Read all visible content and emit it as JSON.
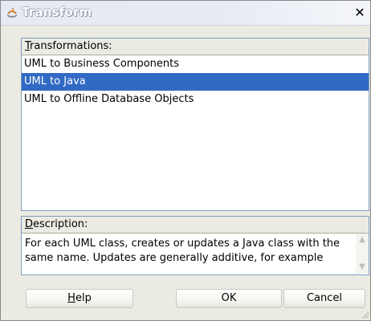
{
  "window": {
    "title": "Transform",
    "close_glyph": "✕",
    "icon": "transform-icon"
  },
  "transformations": {
    "header_accesskey": "T",
    "header_rest": "ransformations:",
    "items": [
      {
        "label": "UML to Business Components",
        "selected": false
      },
      {
        "label": "UML to Java",
        "selected": true
      },
      {
        "label": "UML to Offline Database Objects",
        "selected": false
      }
    ]
  },
  "description": {
    "header_accesskey": "D",
    "header_rest": "escription:",
    "text": "For each UML class, creates or updates a Java class with the same name. Updates are generally additive, for example"
  },
  "buttons": {
    "help_accesskey": "H",
    "help_rest": "elp",
    "ok": "OK",
    "cancel": "Cancel"
  },
  "colors": {
    "selection": "#316ac5",
    "dialog_bg": "#ebebe4",
    "border": "#7f9db9"
  }
}
